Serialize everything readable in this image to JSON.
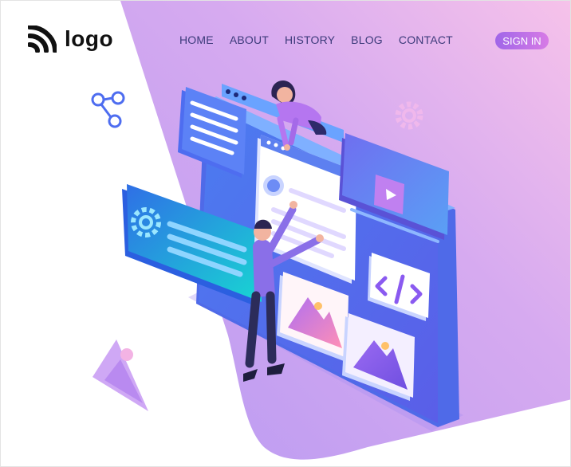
{
  "header": {
    "logo_text": "logo",
    "logo_icon": "rss-feed-icon",
    "nav": [
      {
        "label": "HOME"
      },
      {
        "label": "ABOUT"
      },
      {
        "label": "HISTORY"
      },
      {
        "label": "BLOG"
      },
      {
        "label": "CONTACT"
      }
    ],
    "signin_label": "SIGN IN"
  },
  "decor": {
    "icons": [
      "share-icon",
      "gear-icon",
      "image-icon",
      "code-icon",
      "play-icon"
    ]
  },
  "colors": {
    "nav_text": "#3c3a7a",
    "bg_gradient_start": "#c7a3f3",
    "bg_gradient_end": "#f6c0ea",
    "signin_start": "#a066e8",
    "signin_end": "#d77be6"
  }
}
